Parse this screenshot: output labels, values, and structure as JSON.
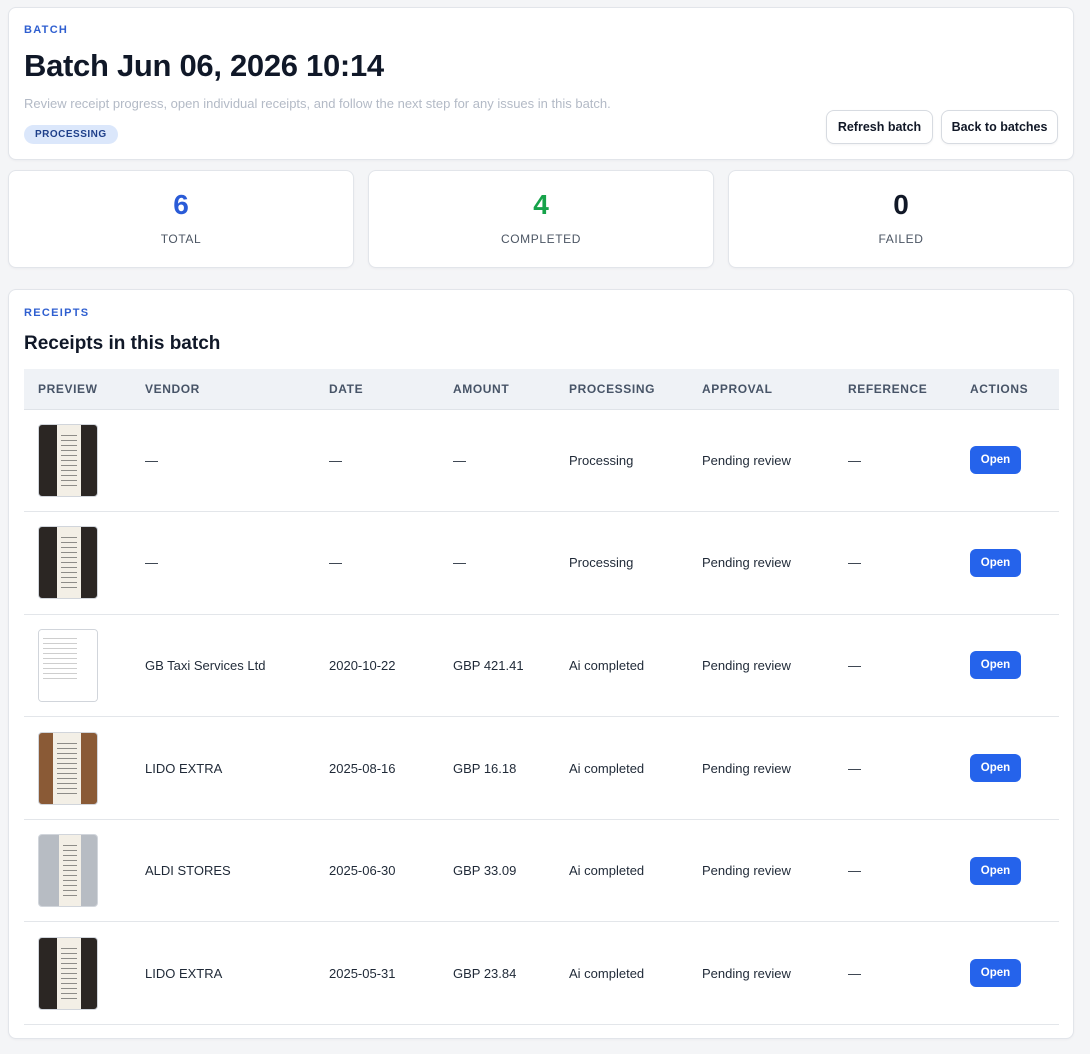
{
  "header": {
    "eyebrow": "BATCH",
    "title": "Batch Jun 06, 2026 10:14",
    "subtitle": "Review receipt progress, open individual receipts, and follow the next step for any issues in this batch.",
    "status": "PROCESSING",
    "refresh_label": "Refresh batch",
    "back_label": "Back to batches"
  },
  "stats": [
    {
      "value": "6",
      "label": "TOTAL",
      "color": "#2a5bd7"
    },
    {
      "value": "4",
      "label": "COMPLETED",
      "color": "#16a34a"
    },
    {
      "value": "0",
      "label": "FAILED",
      "color": "#111827"
    }
  ],
  "receipts": {
    "eyebrow": "RECEIPTS",
    "title": "Receipts in this batch",
    "columns": [
      "PREVIEW",
      "VENDOR",
      "DATE",
      "AMOUNT",
      "PROCESSING",
      "APPROVAL",
      "REFERENCE",
      "ACTIONS"
    ],
    "rows": [
      {
        "thumb": "dark",
        "vendor": "—",
        "date": "—",
        "amount": "—",
        "processing": "Processing",
        "approval": "Pending review",
        "reference": "—",
        "action": "Open"
      },
      {
        "thumb": "dark",
        "vendor": "—",
        "date": "—",
        "amount": "—",
        "processing": "Processing",
        "approval": "Pending review",
        "reference": "—",
        "action": "Open"
      },
      {
        "thumb": "white",
        "vendor": "GB Taxi Services Ltd",
        "date": "2020-10-22",
        "amount": "GBP 421.41",
        "processing": "Ai completed",
        "approval": "Pending review",
        "reference": "—",
        "action": "Open"
      },
      {
        "thumb": "brown",
        "vendor": "LIDO EXTRA",
        "date": "2025-08-16",
        "amount": "GBP 16.18",
        "processing": "Ai completed",
        "approval": "Pending review",
        "reference": "—",
        "action": "Open"
      },
      {
        "thumb": "grey",
        "vendor": "ALDI STORES",
        "date": "2025-06-30",
        "amount": "GBP 33.09",
        "processing": "Ai completed",
        "approval": "Pending review",
        "reference": "—",
        "action": "Open"
      },
      {
        "thumb": "dark",
        "vendor": "LIDO EXTRA",
        "date": "2025-05-31",
        "amount": "GBP 23.84",
        "processing": "Ai completed",
        "approval": "Pending review",
        "reference": "—",
        "action": "Open"
      }
    ]
  },
  "colors": {
    "accent": "#2563eb",
    "badge_bg": "#dbe7fb"
  }
}
